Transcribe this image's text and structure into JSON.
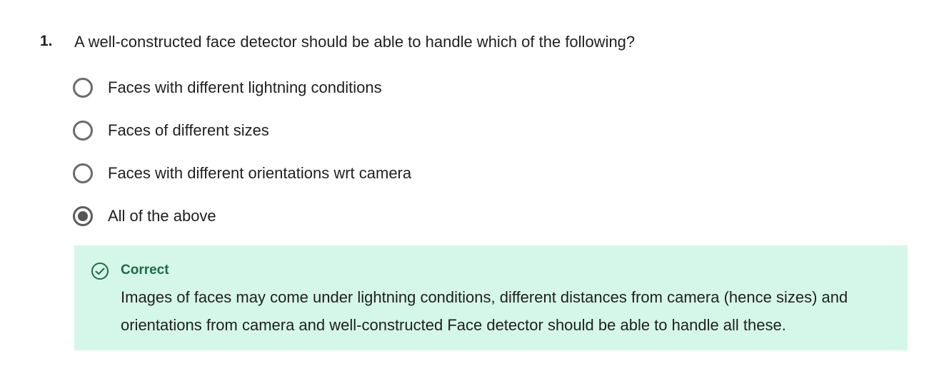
{
  "question": {
    "number": "1.",
    "text": "A well-constructed face detector should be able to handle which of the following?"
  },
  "options": [
    {
      "label": "Faces with different lightning conditions",
      "selected": false
    },
    {
      "label": "Faces of different sizes",
      "selected": false
    },
    {
      "label": "Faces with different orientations wrt camera",
      "selected": false
    },
    {
      "label": "All of the above",
      "selected": true
    }
  ],
  "feedback": {
    "status": "Correct",
    "icon": "check-circle-icon",
    "explanation": "Images of faces may come under lightning conditions, different distances from camera (hence sizes) and orientations from camera and well-constructed Face detector should be able to handle all these.",
    "background_color": "#d5f7ea",
    "accent_color": "#1d6b47"
  }
}
